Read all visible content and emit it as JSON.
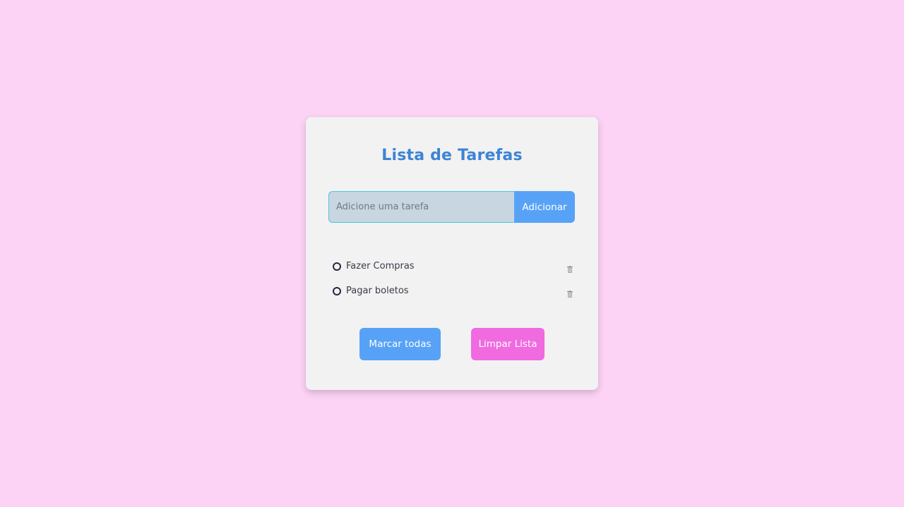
{
  "colors": {
    "background": "#fcd3f5",
    "card": "#f2f2f2",
    "title": "#3c84d6",
    "primary_button": "#57a2f7",
    "danger_button": "#f06ae0",
    "input_background": "#c8d6e2",
    "input_border": "#4fc8d8"
  },
  "app": {
    "title": "Lista de Tarefas"
  },
  "input": {
    "placeholder": "Adicione uma tarefa",
    "value": "",
    "add_label": "Adicionar"
  },
  "tasks": [
    {
      "text": "Fazer Compras",
      "done": false,
      "check_icon": "circle-outline-icon",
      "delete_icon": "trash-icon"
    },
    {
      "text": "Pagar boletos",
      "done": false,
      "check_icon": "circle-outline-icon",
      "delete_icon": "trash-icon"
    }
  ],
  "actions": {
    "mark_all_label": "Marcar todas",
    "clear_label": "Limpar Lista"
  }
}
